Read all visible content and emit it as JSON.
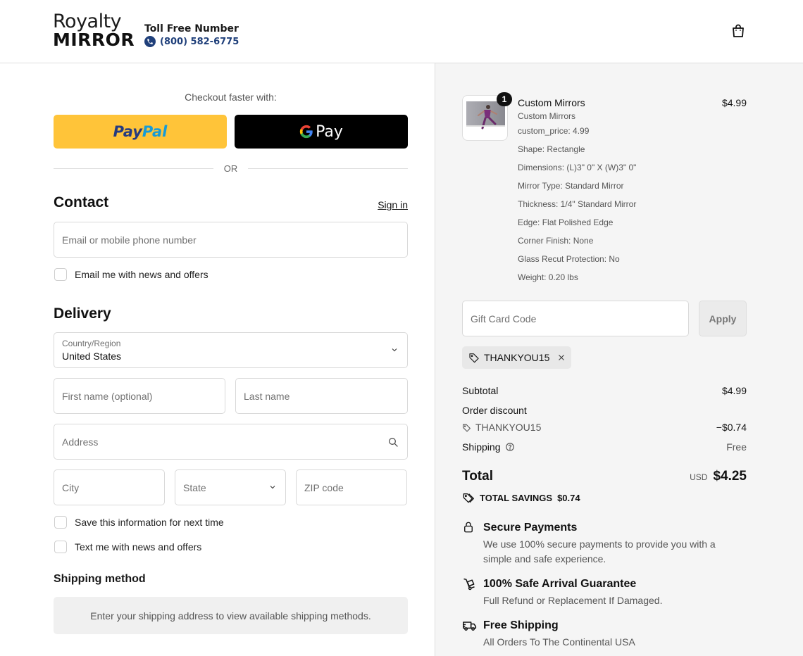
{
  "header": {
    "logo_top": "Royalty",
    "logo_bottom": "MIRROR",
    "toll_title": "Toll Free Number",
    "toll_phone": "(800) 582-6775"
  },
  "express": {
    "label": "Checkout faster with:",
    "paypal_a": "Pay",
    "paypal_b": "Pal",
    "gpay": "Pay",
    "or": "OR"
  },
  "contact": {
    "heading": "Contact",
    "sign_in": "Sign in",
    "email_placeholder": "Email or mobile phone number",
    "news_label": "Email me with news and offers"
  },
  "delivery": {
    "heading": "Delivery",
    "country_label": "Country/Region",
    "country_value": "United States",
    "first_name": "First name (optional)",
    "last_name": "Last name",
    "address": "Address",
    "city": "City",
    "state": "State",
    "zip": "ZIP code",
    "save_info": "Save this information for next time",
    "text_me": "Text me with news and offers"
  },
  "shipping": {
    "heading": "Shipping method",
    "note": "Enter your shipping address to view available shipping methods."
  },
  "order": {
    "quantity": "1",
    "product_name": "Custom Mirrors",
    "product_price": "$4.99",
    "properties": [
      "Custom Mirrors",
      "custom_price: 4.99",
      "Shape: Rectangle",
      "Dimensions: (L)3\" 0\" X (W)3\" 0\"",
      "Mirror Type: Standard Mirror",
      "Thickness: 1/4\" Standard Mirror",
      "Edge: Flat Polished Edge",
      "Corner Finish: None",
      "Glass Recut Protection: No",
      "Weight: 0.20 lbs"
    ],
    "gift_placeholder": "Gift Card Code",
    "apply": "Apply",
    "discount_code": "THANKYOU15"
  },
  "summary": {
    "subtotal_label": "Subtotal",
    "subtotal": "$4.99",
    "order_discount_label": "Order discount",
    "discount_code": "THANKYOU15",
    "discount": "−$0.74",
    "shipping_label": "Shipping",
    "shipping": "Free",
    "total_label": "Total",
    "currency": "USD",
    "total": "$4.25",
    "savings_label": "TOTAL SAVINGS",
    "savings": "$0.74"
  },
  "features": [
    {
      "title": "Secure Payments",
      "text": "We use 100% secure payments to provide you with a simple and safe experience.",
      "icon": "lock-icon"
    },
    {
      "title": "100% Safe Arrival Guarantee",
      "text": "Full Refund or Replacement If Damaged.",
      "icon": "hand-truck-icon"
    },
    {
      "title": "Free Shipping",
      "text": "All Orders To The Continental USA",
      "icon": "truck-icon"
    }
  ],
  "colors": {
    "paypal_yellow": "#ffc439",
    "gpay_black": "#000000",
    "phone_blue": "#1f3f7a",
    "summary_bg": "#f5f5f5"
  }
}
